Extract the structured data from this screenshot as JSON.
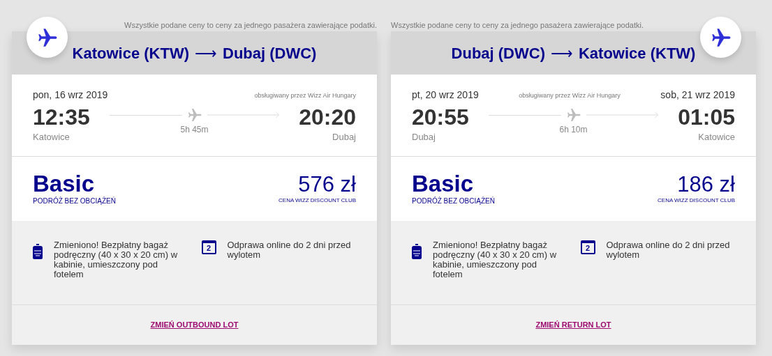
{
  "flights": [
    {
      "notice": "Wszystkie podane ceny to ceny za jednego pasażera zawierające podatki.",
      "kind": "outbound",
      "route": {
        "from": "Katowice (KTW)",
        "arrow": "⟶",
        "to": "Dubaj (DWC)"
      },
      "departure_date": "pon, 16 wrz 2019",
      "operator": "obsługiwany przez Wizz Air Hungary",
      "departure_time": "12:35",
      "departure_city": "Katowice",
      "duration": "5h 45m",
      "arrival_time": "20:20",
      "arrival_city": "Dubaj",
      "fare": {
        "name": "Basic",
        "subtitle": "PODRÓŻ BEZ OBCIĄŻEŃ",
        "price": "576 zł",
        "price_note": "CENA WIZZ DISCOUNT CLUB"
      },
      "features": [
        {
          "kind": "bag",
          "text": "Zmieniono! Bezpłatny bagaż podręczny (40 x 30 x 20 cm) w kabinie, umieszczony pod fotelem"
        },
        {
          "kind": "calendar",
          "icon_text": "2",
          "text": "Odprawa online do 2 dni przed wylotem"
        }
      ],
      "change_link": "ZMIEŃ OUTBOUND LOT"
    },
    {
      "notice": "Wszystkie podane ceny to ceny za jednego pasażera zawierające podatki.",
      "kind": "return",
      "route": {
        "from": "Dubaj (DWC)",
        "arrow": "⟶",
        "to": "Katowice (KTW)"
      },
      "departure_date": "pt, 20 wrz 2019",
      "operator": "obsługiwany przez Wizz Air Hungary",
      "arrival_date": "sob, 21 wrz 2019",
      "departure_time": "20:55",
      "departure_city": "Dubaj",
      "duration": "6h 10m",
      "arrival_time": "01:05",
      "arrival_city": "Katowice",
      "fare": {
        "name": "Basic",
        "subtitle": "PODRÓŻ BEZ OBCIĄŻEŃ",
        "price": "186 zł",
        "price_note": "CENA WIZZ DISCOUNT CLUB"
      },
      "features": [
        {
          "kind": "bag",
          "text": "Zmieniono! Bezpłatny bagaż podręczny (40 x 30 x 20 cm) w kabinie, umieszczony pod fotelem"
        },
        {
          "kind": "calendar",
          "icon_text": "2",
          "text": "Odprawa online do 2 dni przed wylotem"
        }
      ],
      "change_link": "ZMIEŃ RETURN LOT"
    }
  ]
}
